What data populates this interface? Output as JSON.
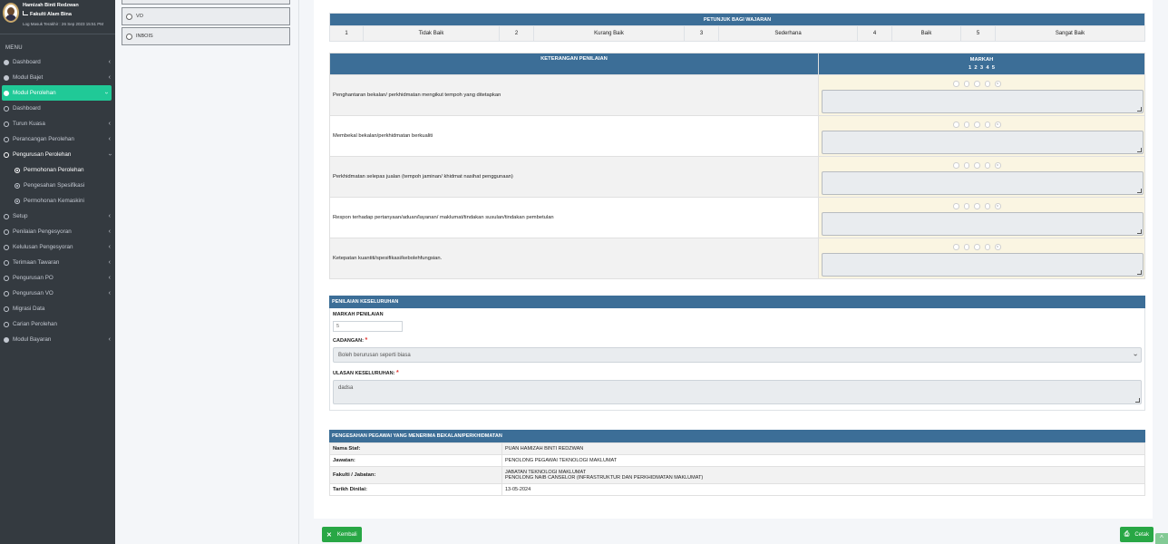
{
  "user": {
    "name": "Hamizah Binti Redzwan",
    "faculty": "Fakulti Alam Bina",
    "last_login": "Log Masuk Terakhir : 26 Sep 2023 15:51 PM"
  },
  "sidebar": {
    "menu_header": "MENU",
    "items": [
      {
        "label": "Dashboard",
        "icon": "dashboard-icon"
      },
      {
        "label": "Modul Bajet",
        "icon": "disk-icon"
      },
      {
        "label": "Modul Perolehan",
        "icon": "disk-icon"
      },
      {
        "label": "Dashboard",
        "icon": "circle-icon"
      },
      {
        "label": "Turun Kuasa",
        "icon": "circle-icon"
      },
      {
        "label": "Perancangan Perolehan",
        "icon": "circle-icon"
      },
      {
        "label": "Pengurusan Perolehan",
        "icon": "circle-icon"
      },
      {
        "label": "Permohonan Perolehan",
        "icon": "dot-circle-icon"
      },
      {
        "label": "Pengesahan Spesifikasi",
        "icon": "dot-circle-icon"
      },
      {
        "label": "Permohonan Kemaskini",
        "icon": "dot-circle-icon"
      },
      {
        "label": "Setup",
        "icon": "circle-icon"
      },
      {
        "label": "Penilaian Pengesyoran",
        "icon": "circle-icon"
      },
      {
        "label": "Kelulusan Pengesyoran",
        "icon": "circle-icon"
      },
      {
        "label": "Terimaan Tawaran",
        "icon": "circle-icon"
      },
      {
        "label": "Pengurusan PO",
        "icon": "circle-icon"
      },
      {
        "label": "Pengurusan VO",
        "icon": "circle-icon"
      },
      {
        "label": "Migrasi Data",
        "icon": "circle-icon"
      },
      {
        "label": "Carian Perolehan",
        "icon": "circle-icon"
      },
      {
        "label": "Modul Bayaran",
        "icon": "disk-icon"
      }
    ]
  },
  "options_panel": {
    "items": [
      "VO",
      "INBOIS"
    ]
  },
  "guide": {
    "title": "PETUNJUK BAGI WAJARAN",
    "scale": [
      {
        "num": "1",
        "label": "Tidak Baik"
      },
      {
        "num": "2",
        "label": "Kurang Baik"
      },
      {
        "num": "3",
        "label": "Sederhana"
      },
      {
        "num": "4",
        "label": "Baik"
      },
      {
        "num": "5",
        "label": "Sangat Baik"
      }
    ]
  },
  "assessment": {
    "col_desc": "KETERANGAN PENILAIAN",
    "col_mark": "MARKAH",
    "mark_scale": "1  2  3  4  5",
    "rows": [
      {
        "criteria": "Penghantaran bekalan/ perkhidmatan mengikut tempoh yang ditetapkan",
        "selected": 5
      },
      {
        "criteria": "Membekal bekalan/perkhidmatan berkualiti",
        "selected": 5
      },
      {
        "criteria": "Perkhidmatan selepas jualan (tempoh jaminan/ khidmat nasihat penggunaan)",
        "selected": 5
      },
      {
        "criteria": "Respon terhadap pertanyaan/aduan/layanan/ maklumat/tindakan susulan/tindakan pembetulan",
        "selected": 5
      },
      {
        "criteria": "Ketepatan kuantiti/spesifikasi/kebolehfungsian.",
        "selected": 5
      }
    ]
  },
  "overall": {
    "title": "PENILAIAN KESELURUHAN",
    "mark_label": "MARKAH PENILAIAN",
    "mark_value": "5",
    "recommend_label": "CADANGAN:",
    "recommend_value": "Boleh berurusan seperti biasa",
    "review_label": "ULASAN KESELURUHAN:",
    "review_value": "dadsa",
    "required_mark": "*"
  },
  "verification": {
    "title": "PENGESAHAN PEGAWAI YANG MENERIMA BEKALAN/PERKHIDMATAN",
    "rows": [
      {
        "key": "Nama Staf:",
        "value": "PUAN HAMIZAH BINTI REDZWAN"
      },
      {
        "key": "Jawatan:",
        "value": "PENOLONG PEGAWAI TEKNOLOGI MAKLUMAT"
      },
      {
        "key": "Fakulti / Jabatan:",
        "value": "JABATAN TEKNOLOGI MAKLUMAT",
        "value2": "PENOLONG NAIB CANSELOR (INFRASTRUKTUR DAN PERKHIDMATAN MAKLUMAT)"
      },
      {
        "key": "Tarikh Dinilai:",
        "value": "13-05-2024"
      }
    ]
  },
  "buttons": {
    "back": "Kembali",
    "print": "Cetak"
  },
  "colors": {
    "sidebar_bg": "#343a40",
    "active_item": "#20c997",
    "header_blue": "#3c6e97",
    "button_green": "#28a745"
  }
}
